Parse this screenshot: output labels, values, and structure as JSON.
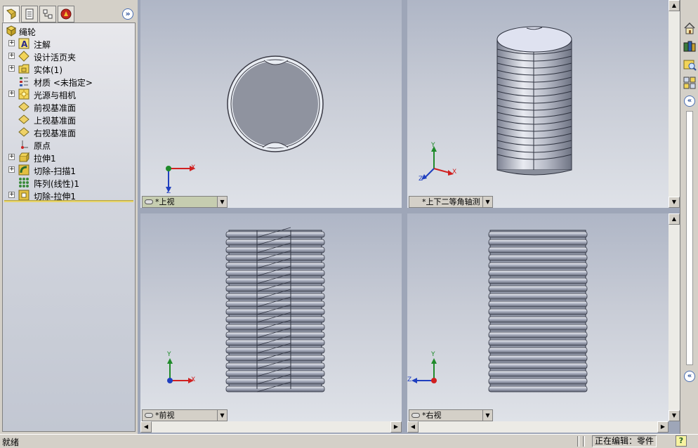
{
  "feature_manager": {
    "root_name": "绳轮",
    "items": [
      {
        "label": "注解",
        "icon": "annotation-icon",
        "expandable": true
      },
      {
        "label": "设计活页夹",
        "icon": "design-binder-icon",
        "expandable": true
      },
      {
        "label": "实体(1)",
        "icon": "solid-bodies-icon",
        "expandable": true
      },
      {
        "label": "材质 <未指定>",
        "icon": "material-icon",
        "expandable": false
      },
      {
        "label": "光源与相机",
        "icon": "lights-cameras-icon",
        "expandable": true
      },
      {
        "label": "前视基准面",
        "icon": "plane-icon",
        "expandable": false
      },
      {
        "label": "上视基准面",
        "icon": "plane-icon",
        "expandable": false
      },
      {
        "label": "右视基准面",
        "icon": "plane-icon",
        "expandable": false
      },
      {
        "label": "原点",
        "icon": "origin-icon",
        "expandable": false
      },
      {
        "label": "拉伸1",
        "icon": "extrude-icon",
        "expandable": true
      },
      {
        "label": "切除-扫描1",
        "icon": "sweep-cut-icon",
        "expandable": true
      },
      {
        "label": "阵列(线性)1",
        "icon": "linear-pattern-icon",
        "expandable": false
      },
      {
        "label": "切除-拉伸1",
        "icon": "extrude-cut-icon",
        "expandable": true
      }
    ]
  },
  "viewports": {
    "top_left": {
      "label": "*上视"
    },
    "top_right": {
      "label": "*上下二等角轴测"
    },
    "bottom_left": {
      "label": "*前视"
    },
    "bottom_right": {
      "label": "*右视"
    }
  },
  "triad": {
    "x": "X",
    "y": "Y",
    "z": "Z"
  },
  "status_bar": {
    "left_text": "就绪",
    "edit_mode": "正在编辑：零件"
  },
  "colors": {
    "viewport_top": "#afb6c6",
    "viewport_bottom": "#dfe2e8",
    "part_fill": "#8e93a6",
    "axis_x": "#d02020",
    "axis_y": "#1f8a2a",
    "axis_z": "#1f3fbf"
  }
}
